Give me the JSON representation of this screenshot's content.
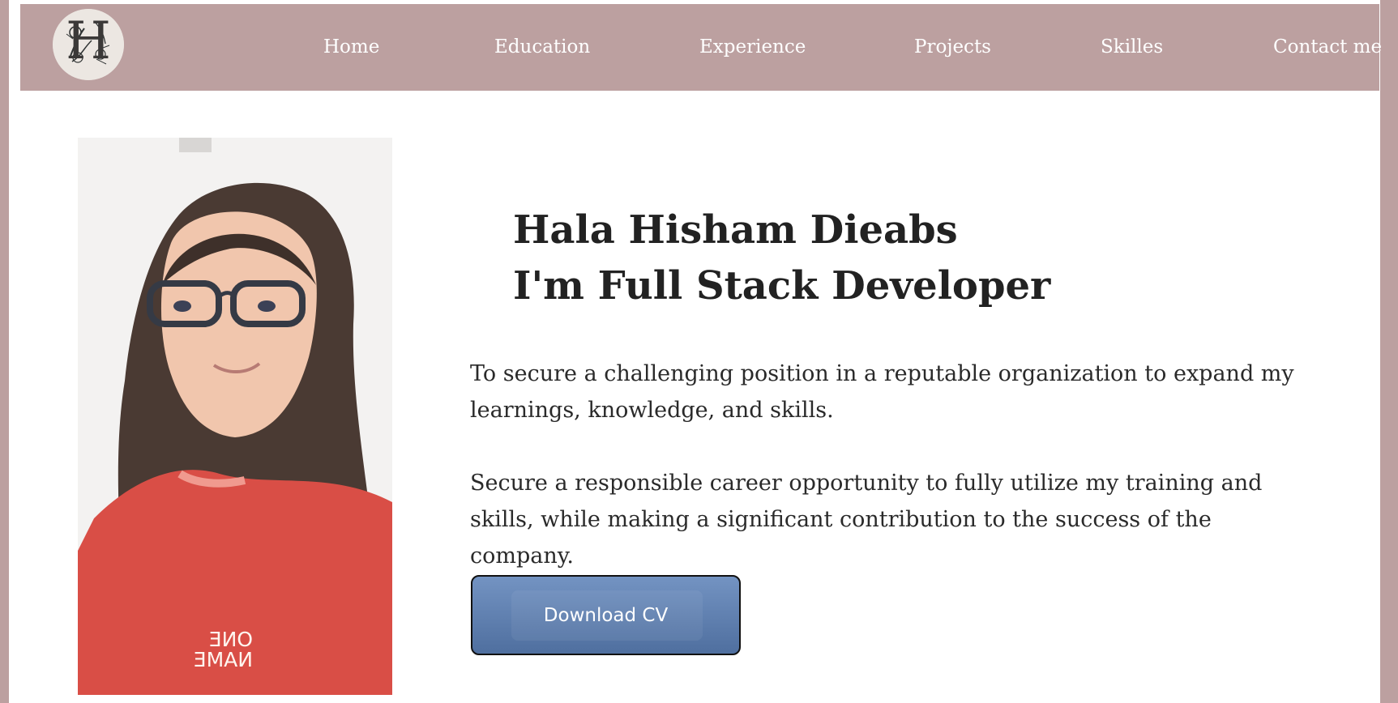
{
  "navbar": {
    "logo_letter": "H",
    "items": [
      {
        "label": "Home"
      },
      {
        "label": "Education"
      },
      {
        "label": "Experience"
      },
      {
        "label": "Projects"
      },
      {
        "label": "Skilles"
      },
      {
        "label": "Contact me"
      }
    ]
  },
  "hero": {
    "name": "Hala Hisham Dieabs",
    "role": "I'm Full Stack Developer",
    "paragraphs": [
      "To secure a challenging position in a reputable organization to expand my learnings, knowledge, and skills.",
      "Secure a responsible career opportunity to fully utilize my training and skills, while making a significant contribution to the success of the company."
    ],
    "download_button": "Download CV"
  },
  "colors": {
    "nav_background": "#bca0a0",
    "page_background": "#ffffff",
    "button_blue": "#5a7cad",
    "text_dark": "#222222"
  },
  "icons": {
    "logo": "floral-monogram-logo",
    "profile": "profile-photo"
  }
}
